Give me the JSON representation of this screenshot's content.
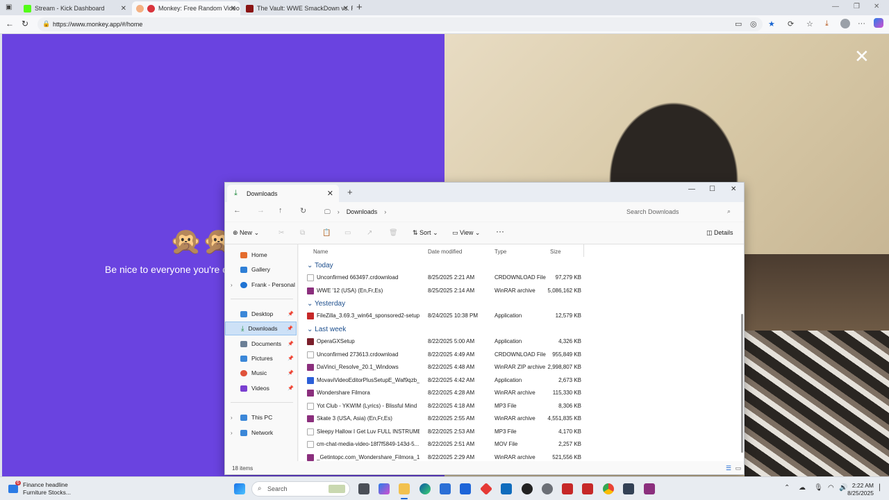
{
  "browser": {
    "tabs": [
      {
        "label": "Stream - Kick Dashboard",
        "favcolor": "#53fc18"
      },
      {
        "label": "Monkey: Free Random Video",
        "favcolor": "#d9343c"
      },
      {
        "label": "The Vault: WWE SmackDown vs. R",
        "favcolor": "#8a1414"
      }
    ],
    "url": "https://www.monkey.app/#/home"
  },
  "page": {
    "emojis": "🙊🙊",
    "tagline": "Be nice to everyone you're c",
    "close_glyph": "✕"
  },
  "explorer": {
    "tab_title": "Downloads",
    "breadcrumb": [
      "Downloads"
    ],
    "search_placeholder": "Search Downloads",
    "toolbar": {
      "new": "New",
      "sort": "Sort",
      "view": "View",
      "more": "···",
      "details": "Details"
    },
    "sidebar": [
      {
        "label": "Home",
        "color": "#e46c2d"
      },
      {
        "label": "Gallery",
        "color": "#2f7fd6"
      },
      {
        "label": "Frank - Personal",
        "color": "#1f74d4"
      },
      {
        "label": "Desktop",
        "color": "#3b87d8"
      },
      {
        "label": "Downloads",
        "color": "#1f8a3d"
      },
      {
        "label": "Documents",
        "color": "#6b7f96"
      },
      {
        "label": "Pictures",
        "color": "#3b87d8"
      },
      {
        "label": "Music",
        "color": "#e0523a"
      },
      {
        "label": "Videos",
        "color": "#7a3fd0"
      },
      {
        "label": "This PC",
        "color": "#3b87d8"
      },
      {
        "label": "Network",
        "color": "#3b87d8"
      }
    ],
    "columns": {
      "name": "Name",
      "date": "Date modified",
      "type": "Type",
      "size": "Size"
    },
    "groups": [
      "Today",
      "Yesterday",
      "Last week"
    ],
    "files": [
      {
        "name": "Unconfirmed 663497.crdownload",
        "date": "8/25/2025 2:21 AM",
        "type": "CRDOWNLOAD File",
        "size": "97,279 KB",
        "color": "#ffffff"
      },
      {
        "name": "WWE '12 (USA) (En,Fr,Es)",
        "date": "8/25/2025 2:14 AM",
        "type": "WinRAR archive",
        "size": "5,086,162 KB",
        "color": "#8b2f7d"
      },
      {
        "name": "FileZilla_3.69.3_win64_sponsored2-setup",
        "date": "8/24/2025 10:38 PM",
        "type": "Application",
        "size": "12,579 KB",
        "color": "#c62828"
      },
      {
        "name": "OperaGXSetup",
        "date": "8/22/2025 5:00 AM",
        "type": "Application",
        "size": "4,326 KB",
        "color": "#7b1f2b"
      },
      {
        "name": "Unconfirmed 273613.crdownload",
        "date": "8/22/2025 4:49 AM",
        "type": "CRDOWNLOAD File",
        "size": "955,849 KB",
        "color": "#ffffff"
      },
      {
        "name": "DaVinci_Resolve_20.1_Windows",
        "date": "8/22/2025 4:48 AM",
        "type": "WinRAR ZIP archive",
        "size": "2,998,807 KB",
        "color": "#8b2f7d"
      },
      {
        "name": "MovaviVideoEditorPlusSetupE_Waf9qzb_",
        "date": "8/22/2025 4:42 AM",
        "type": "Application",
        "size": "2,673 KB",
        "color": "#2c5fd8"
      },
      {
        "name": "Wondershare Filmora",
        "date": "8/22/2025 4:28 AM",
        "type": "WinRAR archive",
        "size": "115,330 KB",
        "color": "#8b2f7d"
      },
      {
        "name": "Yot Club - YKWIM (Lyrics) - Blissful Mind",
        "date": "8/22/2025 4:18 AM",
        "type": "MP3 File",
        "size": "8,306 KB",
        "color": "#ffffff"
      },
      {
        "name": "Skate 3 (USA, Asia) (En,Fr,Es)",
        "date": "8/22/2025 2:55 AM",
        "type": "WinRAR archive",
        "size": "4,551,835 KB",
        "color": "#8b2f7d"
      },
      {
        "name": "Sleepy Hallow I Get Luv FULL INSTRUME...",
        "date": "8/22/2025 2:53 AM",
        "type": "MP3 File",
        "size": "4,170 KB",
        "color": "#ffffff"
      },
      {
        "name": "cm-chat-media-video-18f7f5849-143d-5...",
        "date": "8/22/2025 2:51 AM",
        "type": "MOV File",
        "size": "2,257 KB",
        "color": "#ffffff"
      },
      {
        "name": "_Getintopc.com_Wondershare_Filmora_1...",
        "date": "8/22/2025 2:29 AM",
        "type": "WinRAR archive",
        "size": "521,556 KB",
        "color": "#8b2f7d"
      }
    ],
    "status": "18 items"
  },
  "taskbar": {
    "news_title": "Finance headline",
    "news_sub": "Furniture Stocks...",
    "news_badge": "6",
    "search_placeholder": "Search",
    "time": "2:22 AM",
    "date": "8/25/2025"
  }
}
